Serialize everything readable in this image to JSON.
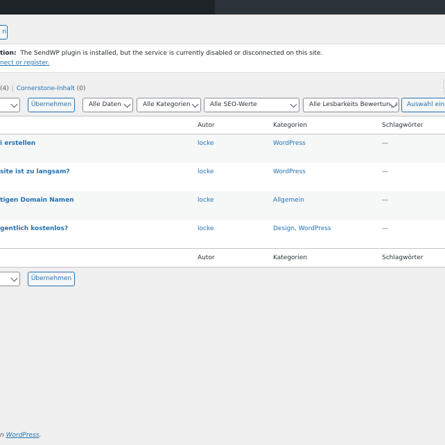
{
  "top_button_label": "n",
  "notice": {
    "label": "tion:",
    "message": "The SendWP plugin is installed, but the service is currently disabled or disconnected on this site.",
    "link": "nect or register."
  },
  "subsubsub": {
    "count_fragment": "(4)",
    "separator": "|",
    "cornerstone_label": "Cornerstone-Inhalt",
    "cornerstone_count": "(0)"
  },
  "filters": {
    "apply_label": "Übernehmen",
    "dates": "Alle Daten",
    "categories": "Alle Kategorien",
    "seo": "Alle SEO-Werte",
    "readability": "Alle Lesbarkeits Bewertungen",
    "filter_button": "Auswahl einschränken"
  },
  "table": {
    "columns": {
      "author": "Autor",
      "categories": "Kategorien",
      "tags": "Schlagwörter"
    },
    "rows": [
      {
        "title": "i erstellen",
        "author": "locke",
        "categories": "WordPress",
        "tags": "—"
      },
      {
        "title": "site ist zu langsam?",
        "author": "locke",
        "categories": "WordPress",
        "tags": "—"
      },
      {
        "title": "tigen Domain Namen",
        "author": "locke",
        "categories": "Allgemein",
        "tags": "—"
      },
      {
        "title": "gentlich kostenlos?",
        "author": "locke",
        "categories": "Design, WordPress",
        "tags": "—"
      }
    ]
  },
  "bottom_apply_label": "Übernehmen",
  "footer": {
    "prefix": "n",
    "link": "WordPress",
    "suffix": "."
  }
}
